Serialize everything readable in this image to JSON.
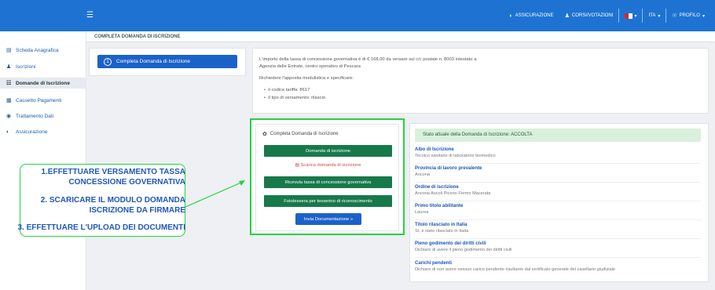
{
  "topbar": {
    "menu_icon": "hamburger-icon",
    "assicurazione": "ASSICURAZIONE",
    "corsi": "CORSI/VOTAZIONI",
    "lang": "ITA",
    "profilo": "PROFILO",
    "accent": "#1e73d2"
  },
  "sidebar": {
    "items": [
      {
        "label": "Scheda Anagrafica",
        "icon": "id-card-icon"
      },
      {
        "label": "Iscrizioni",
        "icon": "user-icon"
      },
      {
        "label": "Domande di Iscrizione",
        "icon": "document-icon"
      },
      {
        "label": "Cassetto Pagamenti",
        "icon": "wallet-icon"
      },
      {
        "label": "Trattamento Dati",
        "icon": "eye-icon"
      },
      {
        "label": "Assicurazione",
        "icon": "shield-icon"
      }
    ]
  },
  "header": {
    "title": "COMPLETA DOMANDA DI ISCRIZIONE"
  },
  "step": {
    "number": "1",
    "label": "Completa Domanda di Iscrizione"
  },
  "info": {
    "line1": "L'importo della tassa di concessione governativa è di € 168,00 da versare sul c/c postale n. 8003 intestato a:",
    "line2": "Agenzia delle Entrate, centro operativo di Pescara",
    "line3": "Richiedere l'apposita modulistica e specificare:",
    "bullets": [
      "il codice tariffa: 8617",
      "il tipo di versamento: rilascio"
    ]
  },
  "documents": {
    "title": "Completa Domanda di Iscrizione",
    "btn_domanda": "Domanda di iscrizione",
    "download_link": "Scarica domanda di iscrizione",
    "btn_ricevuta": "Ricevuta tassa di concessione governativa",
    "btn_foto": "Fototessera per tesserino di riconoscimento",
    "btn_invia": "Invia Documentazione »"
  },
  "status": {
    "text": "Stato attuale della Domanda di Iscrizione: ACCOLTA",
    "fields": [
      {
        "label": "Albo di Iscrizione",
        "value": "Tecnico sanitario di laboratorio biomedico"
      },
      {
        "label": "Provincia di lavoro prevalente",
        "value": "Ancona"
      },
      {
        "label": "Ordine di iscrizione",
        "value": "Ancona Ascoli Piceno Fermo Macerata"
      },
      {
        "label": "Primo titolo abilitante",
        "value": "Laurea"
      },
      {
        "label": "Titolo rilasciato in Italia",
        "value": "Sì, è stato rilasciato in Italia"
      },
      {
        "label": "Pieno godimento dei diritti civili",
        "value": "Dichiaro di avere il pieno godimento dei diritti civili"
      },
      {
        "label": "Carichi pendenti",
        "value": "Dichiaro di non avere nessun carico pendente risultante dal certificato generale del casellario giudiziale"
      }
    ]
  },
  "annotation": {
    "line1a": "1.EFFETTUARE VERSAMENTO TASSA",
    "line1b": "CONCESSIONE GOVERNATIVA",
    "line2a": "2. SCARICARE IL MODULO DOMANDA",
    "line2b": "ISCRIZIONE DA FIRMARE",
    "line3": "3. EFFETTUARE L'UPLOAD DEI DOCUMENTI",
    "color": "#27d141"
  }
}
